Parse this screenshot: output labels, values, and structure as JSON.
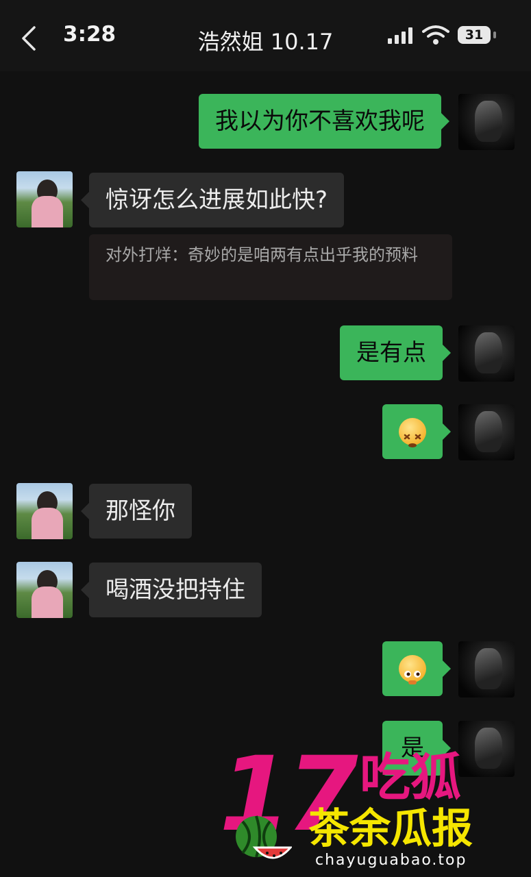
{
  "status_bar": {
    "time": "3:28",
    "battery": "31",
    "icons": [
      "signal-icon",
      "wifi-icon",
      "battery-icon"
    ]
  },
  "header": {
    "title": "浩然姐 10.17",
    "back_icon": "chevron-left-icon"
  },
  "messages": [
    {
      "side": "right",
      "text": "我以为你不喜欢我呢"
    },
    {
      "side": "left",
      "text": "惊讶怎么进展如此快?"
    },
    {
      "side": "left",
      "type": "quote",
      "text": "对外打烊：奇妙的是咱两有点出乎我的预料"
    },
    {
      "side": "right",
      "text": "是有点"
    },
    {
      "side": "right",
      "type": "emoji",
      "icon": "dizzy-face-emoji"
    },
    {
      "side": "left",
      "text": "那怪你"
    },
    {
      "side": "left",
      "text": "喝酒没把持住"
    },
    {
      "side": "right",
      "type": "emoji",
      "icon": "sneaky-face-emoji"
    },
    {
      "side": "right",
      "text": "是"
    }
  ],
  "watermark": {
    "number": "17",
    "brand": "吃狐",
    "subtitle": "茶余瓜报",
    "url": "chayuguabao.top"
  },
  "colors": {
    "background": "#111111",
    "sent_bubble": "#3bb55a",
    "received_bubble": "#2c2c2c",
    "watermark_pink": "#e6177f",
    "watermark_yellow": "#f5e600"
  }
}
